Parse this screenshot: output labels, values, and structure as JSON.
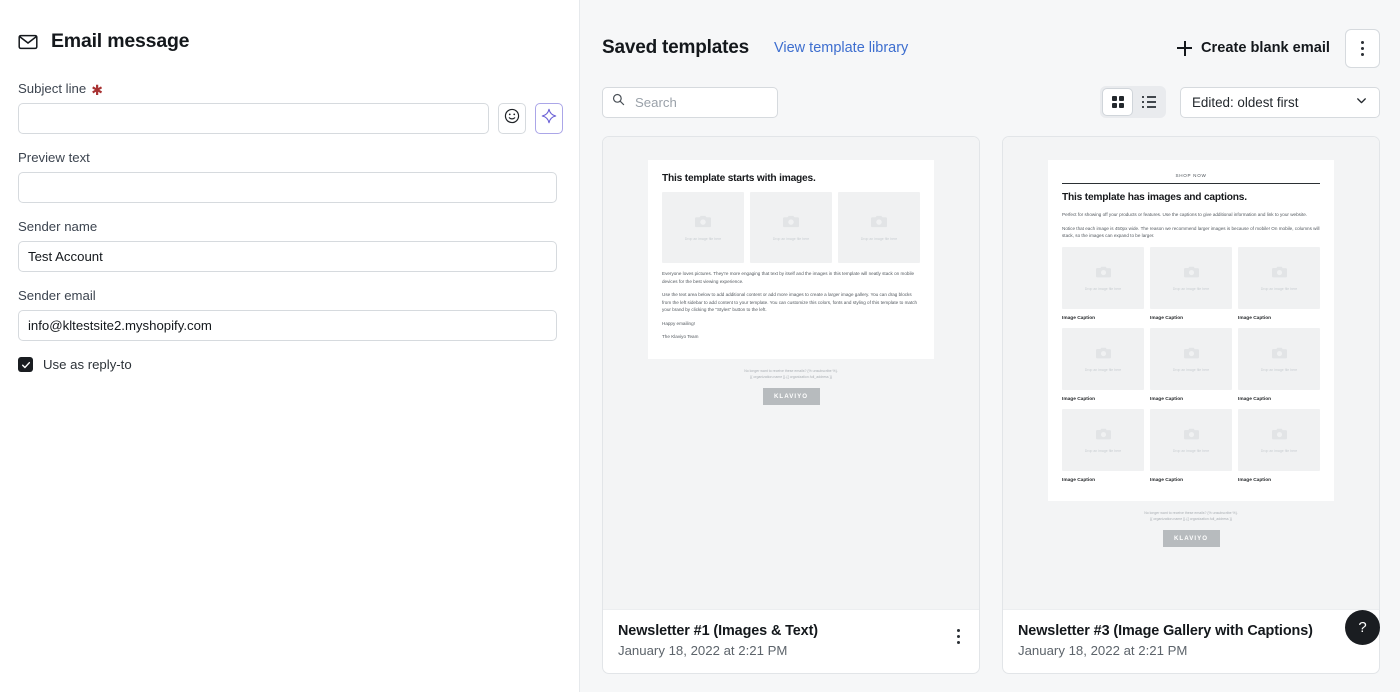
{
  "left_panel": {
    "heading": {
      "title": "Email message",
      "icon": "envelope-icon"
    },
    "fields": [
      {
        "label": "Subject line",
        "required": true,
        "value": "",
        "placeholder": ""
      },
      {
        "label": "Preview text",
        "required": false,
        "value": "",
        "placeholder": ""
      },
      {
        "label": "Sender name",
        "required": false,
        "value": "Test Account",
        "placeholder": ""
      },
      {
        "label": "Sender email",
        "required": false,
        "value": "info@kltestsite2.myshopify.com",
        "placeholder": ""
      }
    ],
    "subject_buttons": [
      {
        "name": "emoji-picker-button",
        "icon": "smiley-icon"
      },
      {
        "name": "ai-suggest-button",
        "icon": "sparkle-icon",
        "accent": "#6b61d6"
      }
    ],
    "checkbox": {
      "label": "Use as reply-to",
      "checked": true
    }
  },
  "right_panel": {
    "title": "Saved templates",
    "library_link": "View template library",
    "create_button": {
      "label": "Create blank email",
      "icon": "plus-icon"
    },
    "overflow_button": {
      "icon": "kebab-vertical-icon"
    },
    "search": {
      "placeholder": "Search",
      "value": ""
    },
    "view_toggle": {
      "options": [
        {
          "name": "grid-view",
          "icon": "grid-icon",
          "selected": true
        },
        {
          "name": "list-view",
          "icon": "list-icon",
          "selected": false
        }
      ]
    },
    "sort": {
      "value": "Edited: oldest first",
      "icon": "chevron-down-icon"
    },
    "help_button": {
      "label": "?"
    },
    "cards": [
      {
        "title": "Newsletter #1 (Images & Text)",
        "date": "January 18, 2022 at 2:21 PM",
        "preview": {
          "shop_now": "",
          "heading": "This template starts with images.",
          "paragraphs": [
            "Everyone loves pictures. They're more engaging that text by itself and the images in this template will neatly stack on mobile devices for the best viewing experience.",
            "Use the text area below to add additional content or add more images to create a larger image gallery. You can drag blocks from the left sidebar to add content to your template. You can customize this colors, fonts and styling of this template to match your brand by clicking the \"Styles\" button to the left.",
            "Happy emailing!",
            "The Klaviyo Team"
          ],
          "image_placeholder_text": "Drop an image file here",
          "image_count": 3,
          "captions": [],
          "footer_line_1": "No longer want to receive these emails? {% unsubscribe %}.",
          "footer_line_2": "{{ organization.name }} {{ organization.full_address }}",
          "logo_text": "KLAVIYO"
        }
      },
      {
        "title": "Newsletter #3 (Image Gallery with Captions)",
        "date": "January 18, 2022 at 2:21 PM",
        "preview": {
          "shop_now": "SHOP NOW",
          "heading": "This template has images and captions.",
          "paragraphs": [
            "Perfect for showing off your products or features. Use the captions to give additional information and link to your website.",
            "Notice that each image is 450px wide. The reason we recommend larger images is because of mobile! On mobile, columns will stack, so the images can expand to be larger."
          ],
          "image_placeholder_text": "Drop an image file here",
          "image_count": 9,
          "captions": [
            "Image Caption",
            "Image Caption",
            "Image Caption"
          ],
          "footer_line_1": "No longer want to receive these emails? {% unsubscribe %}.",
          "footer_line_2": "{{ organization.name }} {{ organization.full_address }}",
          "logo_text": "KLAVIYO"
        }
      }
    ]
  },
  "colors": {
    "link_blue": "#3d6ecf",
    "ai_purple": "#6b61d6",
    "required_red": "#a83232",
    "panel_bg": "#f6f7f8",
    "border": "#d6dade"
  }
}
